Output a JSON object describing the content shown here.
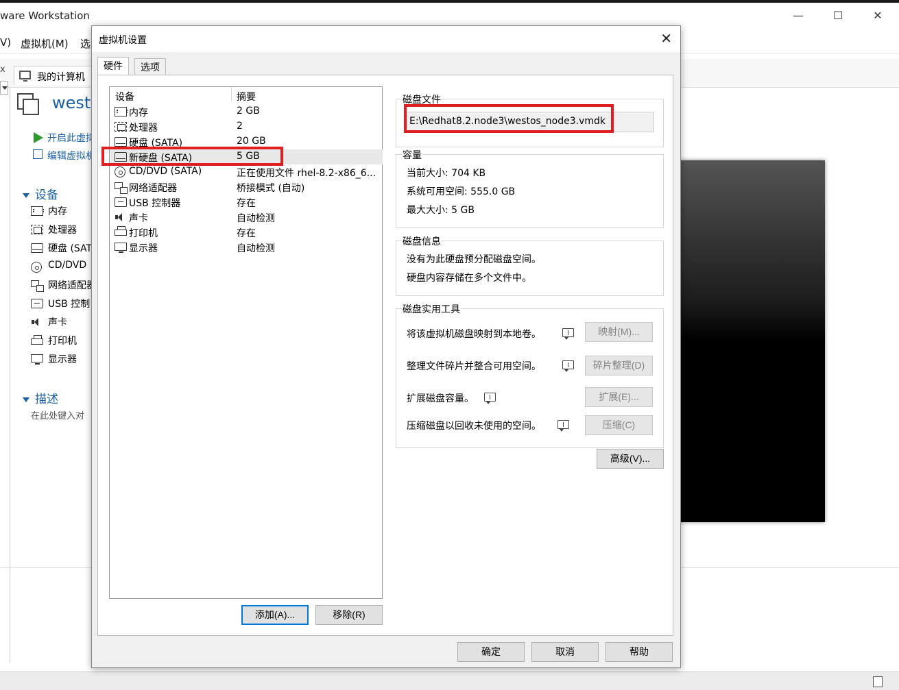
{
  "app": {
    "title": "ware Workstation",
    "menu": [
      "V)",
      "虚拟机(M)",
      "选"
    ],
    "home_tab": "我的计算机",
    "side_close": "x",
    "vm_name": "westo",
    "actions": [
      "开启此虚拟",
      "编辑虚拟机"
    ],
    "devices_heading": "设备",
    "devices": [
      "内存",
      "处理器",
      "硬盘 (SAT",
      "CD/DVD",
      "网络适配器",
      "USB 控制",
      "声卡",
      "打印机",
      "显示器"
    ],
    "description_heading": "描述",
    "description_placeholder": "在此处键入对"
  },
  "dialog": {
    "title": "虚拟机设置",
    "tabs": [
      "硬件",
      "选项"
    ],
    "columns": {
      "device": "设备",
      "summary": "摘要"
    },
    "devices": [
      {
        "name": "内存",
        "summary": "2 GB",
        "icon": "memory-icon"
      },
      {
        "name": "处理器",
        "summary": "2",
        "icon": "cpu-icon"
      },
      {
        "name": "硬盘 (SATA)",
        "summary": "20 GB",
        "icon": "disk-icon"
      },
      {
        "name": "新硬盘 (SATA)",
        "summary": "5 GB",
        "icon": "disk-icon"
      },
      {
        "name": "CD/DVD (SATA)",
        "summary": "正在使用文件 rhel-8.2-x86_6...",
        "icon": "cd-icon"
      },
      {
        "name": "网络适配器",
        "summary": "桥接模式 (自动)",
        "icon": "network-icon"
      },
      {
        "name": "USB 控制器",
        "summary": "存在",
        "icon": "usb-icon"
      },
      {
        "name": "声卡",
        "summary": "自动检测",
        "icon": "sound-icon"
      },
      {
        "name": "打印机",
        "summary": "存在",
        "icon": "printer-icon"
      },
      {
        "name": "显示器",
        "summary": "自动检测",
        "icon": "display-icon"
      }
    ],
    "selected_index": 3,
    "add_button": "添加(A)...",
    "remove_button": "移除(R)",
    "disk_file": {
      "label": "磁盘文件",
      "path": "E:\\Redhat8.2.node3\\westos_node3.vmdk"
    },
    "capacity": {
      "label": "容量",
      "current": "当前大小: 704 KB",
      "available": "系统可用空间: 555.0 GB",
      "max": "最大大小: 5 GB"
    },
    "disk_info": {
      "label": "磁盘信息",
      "line1": "没有为此硬盘预分配磁盘空间。",
      "line2": "硬盘内容存储在多个文件中。"
    },
    "utilities": {
      "label": "磁盘实用工具",
      "map_text": "将该虚拟机磁盘映射到本地卷。",
      "map_button": "映射(M)...",
      "defrag_text": "整理文件碎片并整合可用空间。",
      "defrag_button": "碎片整理(D)",
      "expand_text": "扩展磁盘容量。",
      "expand_button": "扩展(E)...",
      "compact_text": "压缩磁盘以回收未使用的空间。",
      "compact_button": "压缩(C)"
    },
    "advanced_button": "高级(V)...",
    "ok_button": "确定",
    "cancel_button": "取消",
    "help_button": "帮助",
    "highlight_color": "#e02020"
  }
}
